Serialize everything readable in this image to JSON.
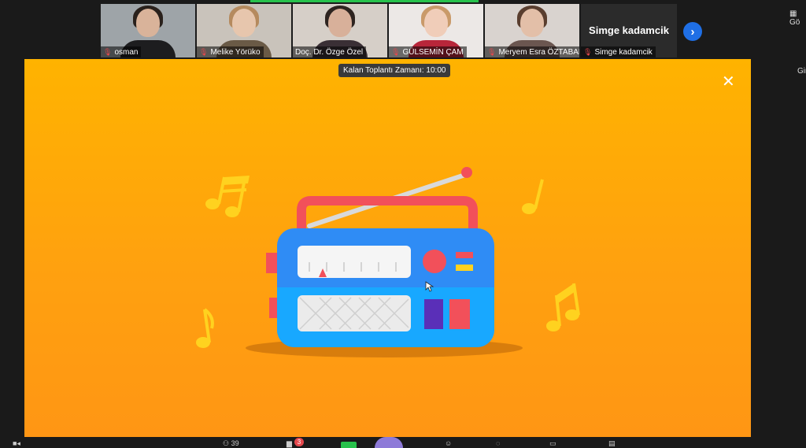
{
  "participants": [
    {
      "name": "osman",
      "skin": "#d9b39a",
      "hair": "#2a211c",
      "shirt": "#1d1d1f",
      "bg": "#9ea4a8"
    },
    {
      "name": "Melike Yörükо",
      "skin": "#e7c6ad",
      "hair": "#b58a5e",
      "shirt": "#6a5a46",
      "bg": "#c9c3bb"
    },
    {
      "name": "Doç. Dr. Özge Özel",
      "skin": "#d8b09a",
      "hair": "#2e2420",
      "shirt": "#3a2f35",
      "bg": "#d6cfc8"
    },
    {
      "name": "GÜLSEMİN ÇAM",
      "skin": "#f0cdb9",
      "hair": "#c99a6a",
      "shirt": "#b8263a",
      "bg": "#ece8e6"
    },
    {
      "name": "Meryem Esra ÖZTABAK",
      "skin": "#e3bfa8",
      "hair": "#5a3e2f",
      "shirt": "#6b5650",
      "bg": "#d9d3cf"
    }
  ],
  "self_tile": {
    "big_name": "Simge kadamcik",
    "name": "Simge kadamcik"
  },
  "next_icon": "chevron-right-icon",
  "right_panel": {
    "text": "Gir",
    "icon_text": "Gö"
  },
  "stage": {
    "timer": "Kalan Toplantı Zamanı: 10:00",
    "close_icon": "close-icon",
    "bg_color": "#ffa10f"
  },
  "toolbar": {
    "participants_count": "39",
    "chat_badge": "3"
  },
  "colors": {
    "radio_body": "#2f8cf5",
    "radio_handle": "#f2505a",
    "note": "#ffd21f",
    "accent_green": "#27c24c",
    "zoom_blue": "#1f6fe5"
  }
}
